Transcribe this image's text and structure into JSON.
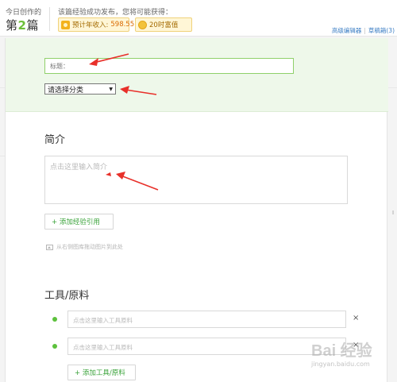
{
  "topbar": {
    "today_label": "今日创作的",
    "today_prefix": "第",
    "today_num": "2",
    "today_suffix": "篇",
    "publish_note": "该篇经验成功发布，您将可能获得：",
    "income_label": "预计年收入:",
    "income_value": "598.55",
    "time_reward": "20时富值",
    "links": [
      "高级编辑器",
      "草稿箱(3)"
    ]
  },
  "form": {
    "title_placeholder": "标题：",
    "category_selected": "请选择分类",
    "intro_heading": "简介",
    "intro_placeholder": "点击这里输入简介",
    "add_ref_button": "+ 添加经验引用",
    "drag_hint": "从右侧图库拖动图片到此处",
    "tools_heading": "工具/原料",
    "tool_placeholders": [
      "点击这里输入工具原料",
      "点击这里输入工具原料"
    ],
    "remove_label": "×",
    "add_tool_button": "+ 添加工具/原料"
  },
  "watermark": {
    "text": "Bai 经验",
    "url": "jingyan.baidu.com"
  },
  "colors": {
    "accent_green": "#6dbf3a",
    "annotation_red": "#e8302a",
    "header_tint": "#eef8ea",
    "badge_bg": "#fff6d6"
  }
}
